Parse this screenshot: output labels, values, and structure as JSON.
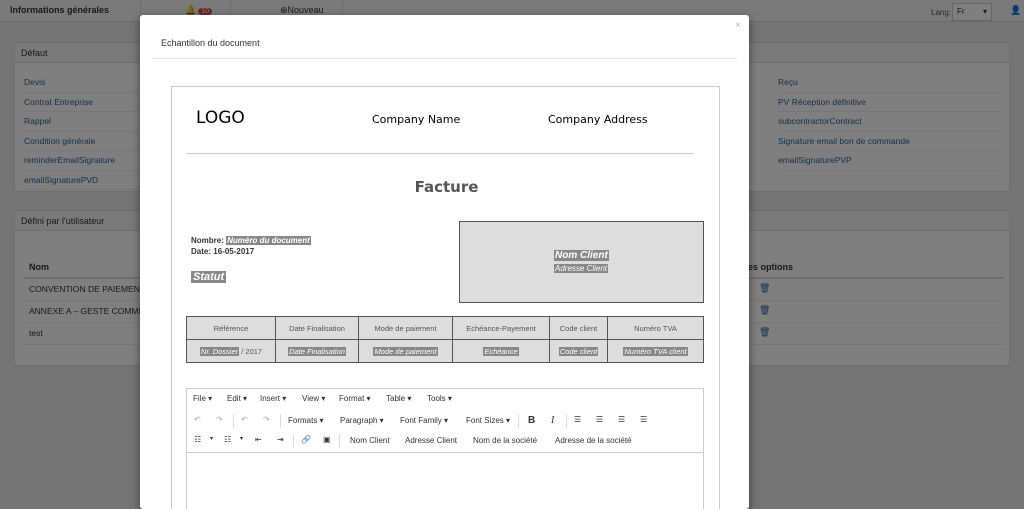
{
  "topbar": {
    "title": "Informations générales",
    "notifications_count": "10",
    "new_label": "Nouveau",
    "lang_label": "Lang:",
    "lang_value": "Fr"
  },
  "panel_default": {
    "title": "Défaut",
    "left_links": [
      "Devis",
      "Contrat Entreprise",
      "Rappel",
      "Condition générale",
      "reminderEmailSignature",
      "emailSignaturePVD"
    ],
    "right_links": [
      "Reçu",
      "PV Réception définitive",
      "subcontractorContract",
      "Signature email bon de commande",
      "emailSignaturePVP"
    ]
  },
  "panel_user": {
    "title": "Défini par l'utilisateur",
    "col_name": "Nom",
    "col_options": "es options",
    "rows": [
      "CONVENTION DE PAIEMENT E",
      "ANNEXE A – GESTE COMMERC",
      "test"
    ]
  },
  "modal": {
    "title": "Echantillon du document",
    "close": "×"
  },
  "document": {
    "logo": "LOGO",
    "company_name": "Company Name",
    "company_address": "Company Address",
    "heading": "Facture",
    "number_label": "Nombre:",
    "number_value": "Numéro du document",
    "date_label": "Date:",
    "date_value": "16-05-2017",
    "status": "Statut",
    "client_name": "Nom Client",
    "client_address": "Adresse Client",
    "table_headers": [
      "Référence",
      "Date Finalisation",
      "Mode de paiement",
      "Echéance-Payement",
      "Code client",
      "Numéro TVA"
    ],
    "table_ref_value": "Nr. Dossier",
    "table_ref_suffix": " / 2017",
    "table_values": [
      "Date Finalisation",
      "Mode de paiement",
      "Echéance",
      "Code client",
      "Numéro TVA client"
    ]
  },
  "editor": {
    "menus": [
      "File ▾",
      "Edit ▾",
      "Insert ▾",
      "View ▾",
      "Format ▾",
      "Table ▾",
      "Tools ▾"
    ],
    "formats": "Formats ▾",
    "paragraph": "Paragraph ▾",
    "font_family": "Font Family ▾",
    "font_sizes": "Font Sizes ▾",
    "insert_buttons": [
      "Nom Client",
      "Adresse Client",
      "Nom de la société",
      "Adresse de la société"
    ]
  }
}
